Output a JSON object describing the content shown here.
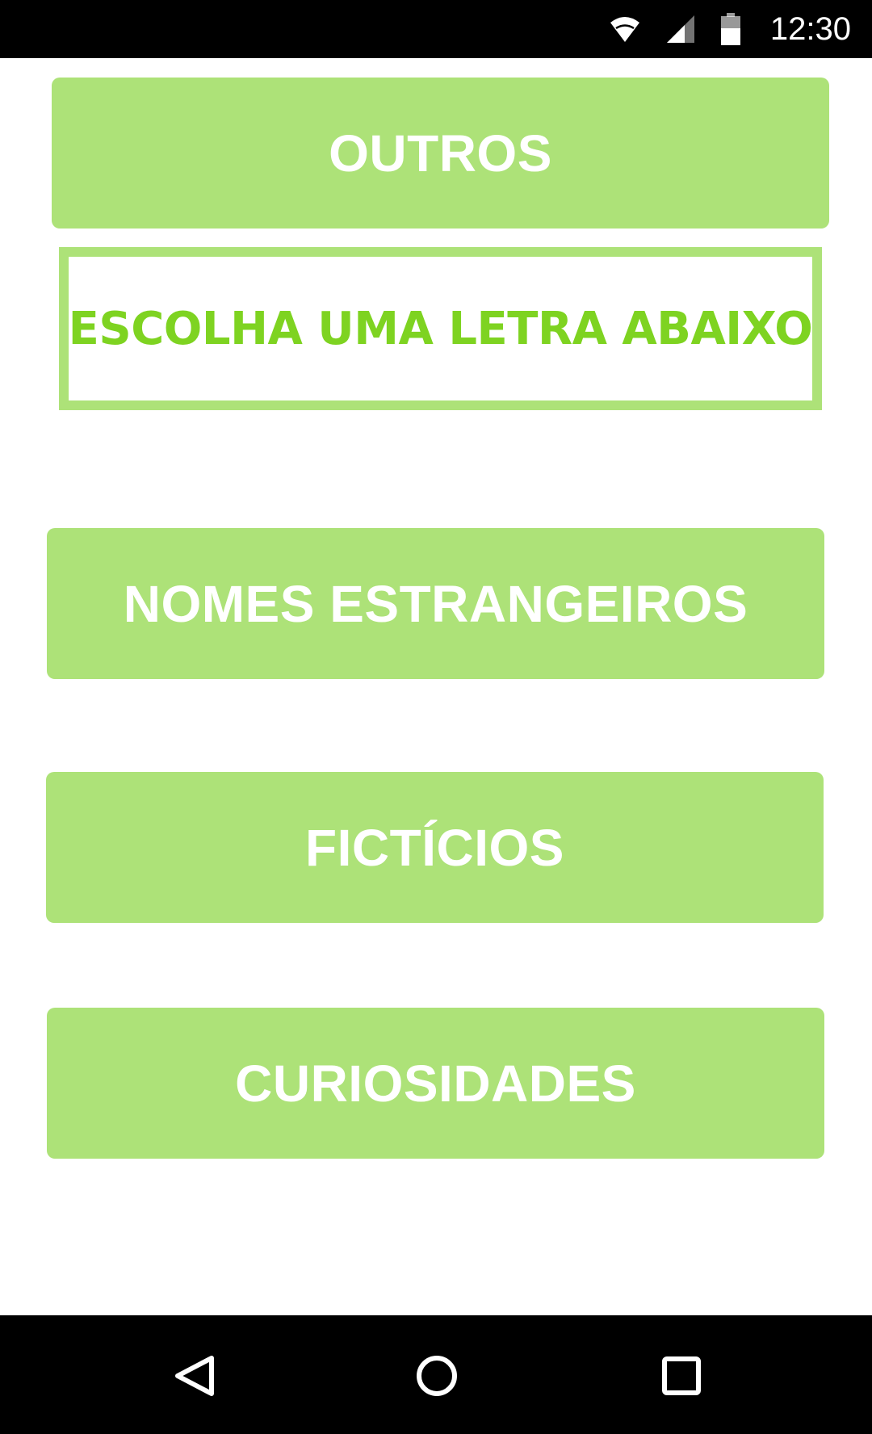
{
  "status_bar": {
    "time": "12:30",
    "icons": [
      "wifi-icon",
      "signal-icon",
      "battery-icon"
    ]
  },
  "menu": {
    "outros_label": "OUTROS",
    "instruction": "ESCOLHA UMA LETRA ABAIXO",
    "estrangeiros_label": "NOMES ESTRANGEIROS",
    "ficticios_label": "FICTÍCIOS",
    "curiosidades_label": "CURIOSIDADES"
  },
  "nav_bar": {
    "icons": [
      "back-icon",
      "home-icon",
      "recents-icon"
    ]
  },
  "colors": {
    "button_background": "#ade278",
    "button_text": "#ffffff",
    "instruction_text": "#7ed321",
    "bars": "#000000"
  }
}
